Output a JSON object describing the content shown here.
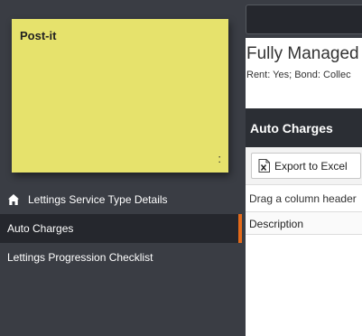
{
  "postit": {
    "title": "Post-it",
    "menu_glyph": ":"
  },
  "nav": {
    "items": [
      {
        "label": "Lettings Service Type Details",
        "icon": "home-icon",
        "active": false
      },
      {
        "label": "Auto Charges",
        "icon": "",
        "active": true
      },
      {
        "label": "Lettings Progression Checklist",
        "icon": "",
        "active": false
      }
    ]
  },
  "main": {
    "heading": "Fully Managed",
    "subheading": "Rent: Yes; Bond: Collec",
    "panel_title": "Auto Charges",
    "export_label": "Export to Excel",
    "drag_hint": "Drag a column header",
    "columns": [
      "Description"
    ]
  },
  "colors": {
    "sidebar_bg": "#3a3d44",
    "active_bg": "#25272d",
    "active_accent": "#e46a1a",
    "postit_bg": "#e6e26c",
    "panel_header_bg": "#2b2e34"
  }
}
